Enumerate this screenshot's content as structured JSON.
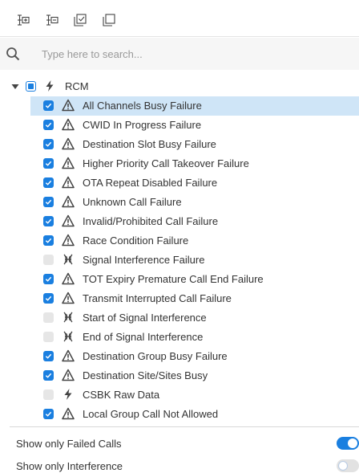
{
  "toolbar": {
    "buttons": [
      {
        "name": "expand-all-icon"
      },
      {
        "name": "collapse-all-icon"
      },
      {
        "name": "select-all-icon"
      },
      {
        "name": "deselect-all-icon"
      }
    ]
  },
  "search": {
    "placeholder": "Type here to search...",
    "value": ""
  },
  "tree": {
    "root": {
      "label": "RCM",
      "icon": "lightning-icon",
      "checked": "partial",
      "expanded": true
    },
    "items": [
      {
        "label": "All Channels Busy Failure",
        "icon": "warning-icon",
        "checked": true,
        "selected": true
      },
      {
        "label": "CWID In Progress Failure",
        "icon": "warning-icon",
        "checked": true
      },
      {
        "label": "Destination Slot Busy Failure",
        "icon": "warning-icon",
        "checked": true
      },
      {
        "label": "Higher Priority Call Takeover Failure",
        "icon": "warning-icon",
        "checked": true
      },
      {
        "label": "OTA Repeat Disabled Failure",
        "icon": "warning-icon",
        "checked": true
      },
      {
        "label": "Unknown Call Failure",
        "icon": "warning-icon",
        "checked": true
      },
      {
        "label": "Invalid/Prohibited Call Failure",
        "icon": "warning-icon",
        "checked": true
      },
      {
        "label": "Race Condition Failure",
        "icon": "warning-icon",
        "checked": true
      },
      {
        "label": "Signal Interference Failure",
        "icon": "interference-icon",
        "checked": false
      },
      {
        "label": "TOT Expiry Premature Call End Failure",
        "icon": "warning-icon",
        "checked": true
      },
      {
        "label": "Transmit Interrupted Call Failure",
        "icon": "warning-icon",
        "checked": true
      },
      {
        "label": "Start of Signal Interference",
        "icon": "interference-icon",
        "checked": false
      },
      {
        "label": "End of Signal Interference",
        "icon": "interference-icon",
        "checked": false
      },
      {
        "label": "Destination Group Busy Failure",
        "icon": "warning-icon",
        "checked": true
      },
      {
        "label": "Destination Site/Sites Busy",
        "icon": "warning-icon",
        "checked": true
      },
      {
        "label": "CSBK Raw Data",
        "icon": "lightning-icon",
        "checked": false
      },
      {
        "label": "Local Group Call Not Allowed",
        "icon": "warning-icon",
        "checked": true
      }
    ]
  },
  "options": [
    {
      "label": "Show only Failed Calls",
      "enabled": true
    },
    {
      "label": "Show only Interference",
      "enabled": false
    }
  ],
  "colors": {
    "accent": "#1a7fe0",
    "selected_row": "#cfe5f7",
    "icon": "#444444"
  }
}
